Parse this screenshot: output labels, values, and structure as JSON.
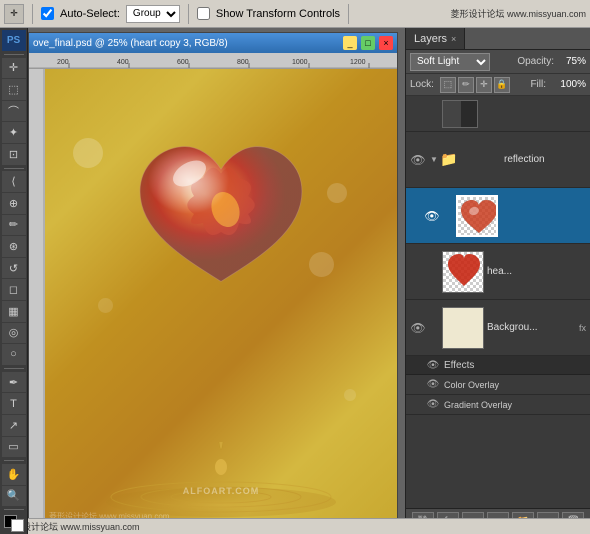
{
  "toolbar": {
    "auto_select_label": "Auto-Select:",
    "auto_select_option": "Group",
    "show_transform_label": "Show Transform Controls",
    "site_watermark": "菱形设计论坛 www.missyuan.com"
  },
  "doc_window": {
    "title": "ove_final.psd @ 25% (heart copy 3, RGB/8)",
    "ruler_marks": [
      "200",
      "400",
      "600",
      "800",
      "1000",
      "1200"
    ]
  },
  "layers_panel": {
    "tab_label": "Layers",
    "tab_close": "×",
    "blend_mode": "Soft Light",
    "opacity_label": "Opacity:",
    "opacity_value": "75%",
    "lock_label": "Lock:",
    "fill_label": "Fill:",
    "fill_value": "100%",
    "layers": [
      {
        "id": 0,
        "name": "",
        "type": "dark-thumbnail",
        "visible": false,
        "has_arrow": false,
        "is_group": false,
        "selected": false,
        "show_eye": false
      },
      {
        "id": 1,
        "name": "reflection",
        "type": "group",
        "visible": true,
        "has_arrow": true,
        "is_group": true,
        "selected": false,
        "show_eye": true
      },
      {
        "id": 2,
        "name": "",
        "type": "heart-thumbnail",
        "visible": true,
        "has_arrow": false,
        "is_group": false,
        "selected": true,
        "show_eye": true,
        "is_sublayer": true
      },
      {
        "id": 3,
        "name": "hea...",
        "type": "heart-small",
        "visible": true,
        "has_arrow": false,
        "is_group": false,
        "selected": false,
        "show_eye": false
      },
      {
        "id": 4,
        "name": "Backgrou...",
        "type": "white",
        "visible": true,
        "has_arrow": false,
        "is_group": false,
        "selected": false,
        "show_eye": true,
        "has_fx": true
      }
    ],
    "effects": {
      "header": "Effects",
      "items": [
        "Color Overlay",
        "Gradient Overlay"
      ]
    },
    "bottom_buttons": [
      "fx",
      "●",
      "□",
      "⊖",
      "🗑"
    ]
  },
  "bottom_bar": {
    "left_text": "菱形设计论坛 www.missyuan.com"
  },
  "canvas": {
    "watermark": "ALFOART.COM"
  }
}
